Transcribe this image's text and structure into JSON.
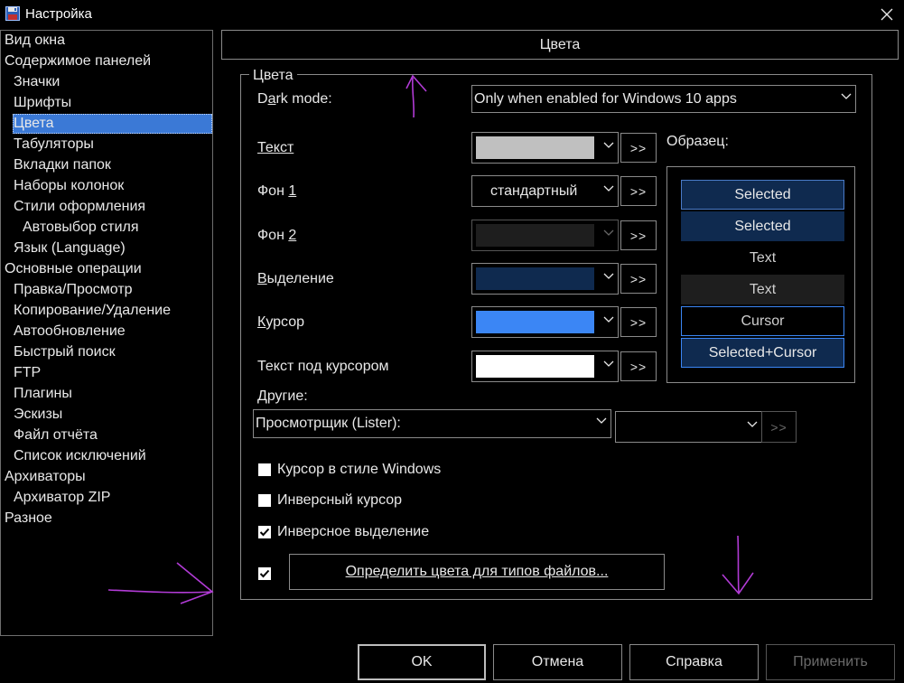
{
  "window": {
    "title": "Настройка",
    "close_icon": "close-icon",
    "app_icon": "floppy-disk-icon"
  },
  "sidebar": {
    "items": [
      {
        "label": "Вид окна",
        "level": 0
      },
      {
        "label": "Содержимое панелей",
        "level": 0
      },
      {
        "label": "Значки",
        "level": 1
      },
      {
        "label": "Шрифты",
        "level": 1
      },
      {
        "label": "Цвета",
        "level": 1,
        "selected": true
      },
      {
        "label": "Табуляторы",
        "level": 1
      },
      {
        "label": "Вкладки папок",
        "level": 1
      },
      {
        "label": "Наборы колонок",
        "level": 1
      },
      {
        "label": "Стили оформления",
        "level": 1
      },
      {
        "label": "Автовыбор стиля",
        "level": 2
      },
      {
        "label": "Язык (Language)",
        "level": 1
      },
      {
        "label": "Основные операции",
        "level": 0
      },
      {
        "label": "Правка/Просмотр",
        "level": 1
      },
      {
        "label": "Копирование/Удаление",
        "level": 1
      },
      {
        "label": "Автообновление",
        "level": 1
      },
      {
        "label": "Быстрый поиск",
        "level": 1
      },
      {
        "label": "FTP",
        "level": 1
      },
      {
        "label": "Плагины",
        "level": 1
      },
      {
        "label": "Эскизы",
        "level": 1
      },
      {
        "label": "Файл отчёта",
        "level": 1
      },
      {
        "label": "Список исключений",
        "level": 1
      },
      {
        "label": "Архиваторы",
        "level": 0
      },
      {
        "label": "Архиватор ZIP",
        "level": 1
      },
      {
        "label": "Разное",
        "level": 0
      }
    ]
  },
  "header": {
    "title": "Цвета"
  },
  "group": {
    "legend": "Цвета"
  },
  "dark_mode": {
    "label": "Dark mode:",
    "value": "Only when enabled for Windows 10 apps"
  },
  "colors": {
    "text": {
      "label": "Текст",
      "color": "#c0c0c0"
    },
    "bg1": {
      "label": "Фон 1",
      "value": "стандартный"
    },
    "bg2": {
      "label": "Фон 2",
      "color": "#1e1e1e"
    },
    "selection": {
      "label": "Выделение",
      "color": "#0f2a4f"
    },
    "cursor": {
      "label": "Курсор",
      "color": "#3b86f5"
    },
    "cursor_text": {
      "label": "Текст под курсором",
      "color": "#ffffff"
    },
    "more_label": ">>"
  },
  "others": {
    "label": "Другие:",
    "value": "Просмотрщик (Lister):",
    "color": "#000000",
    "more_label": ">>"
  },
  "sample": {
    "label": "Образец:",
    "rows": [
      "Selected",
      "Selected",
      "Text",
      "Text",
      "Cursor",
      "Selected+Cursor"
    ]
  },
  "checkboxes": {
    "windows_cursor": {
      "label": "Курсор в стиле Windows",
      "checked": false
    },
    "inverse_cursor": {
      "label": "Инверсный курсор",
      "checked": false
    },
    "inverse_selection": {
      "label": "Инверсное выделение",
      "checked": true
    },
    "filetype_colors": {
      "checked": true
    }
  },
  "filetype_button": {
    "label": "Определить цвета для типов файлов..."
  },
  "buttons": {
    "ok": "OK",
    "cancel": "Отмена",
    "help": "Справка",
    "apply": "Применить"
  }
}
